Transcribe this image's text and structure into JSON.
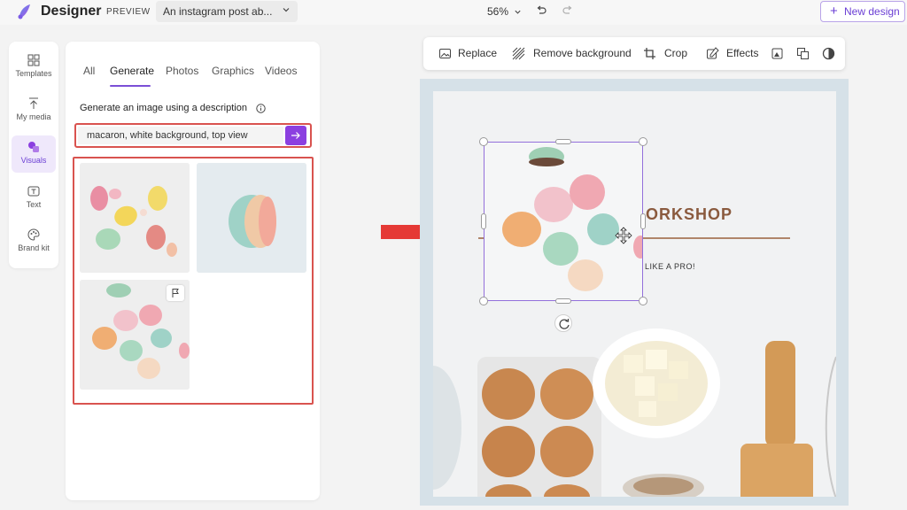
{
  "app": {
    "title": "Designer",
    "preview_tag": "PREVIEW",
    "document_name": "An instagram post ab...",
    "zoom": "56%",
    "new_design_label": "New design",
    "accent_color": "#8b3fe0"
  },
  "rail": {
    "items": [
      {
        "label": "Templates",
        "icon": "templates-icon"
      },
      {
        "label": "My media",
        "icon": "upload-icon"
      },
      {
        "label": "Visuals",
        "icon": "visuals-icon",
        "active": true
      },
      {
        "label": "Text",
        "icon": "text-icon"
      },
      {
        "label": "Brand kit",
        "icon": "palette-icon"
      }
    ]
  },
  "panel": {
    "tabs": [
      "All",
      "Generate",
      "Photos",
      "Graphics",
      "Videos"
    ],
    "active_tab": "Generate",
    "generate_label": "Generate an image using a description",
    "prompt_value": "macaron, white background, top view",
    "results": [
      "macarons-scattered-colorful",
      "single-macaron-side-view",
      "pastel-macarons-top-view"
    ]
  },
  "toolbar": {
    "replace": "Replace",
    "remove_background": "Remove background",
    "crop": "Crop",
    "effects": "Effects"
  },
  "canvas": {
    "headline_fragment": "ORKSHOP",
    "subline_fragment": "LIKE A PRO!",
    "annotation_color": "#e53935"
  }
}
